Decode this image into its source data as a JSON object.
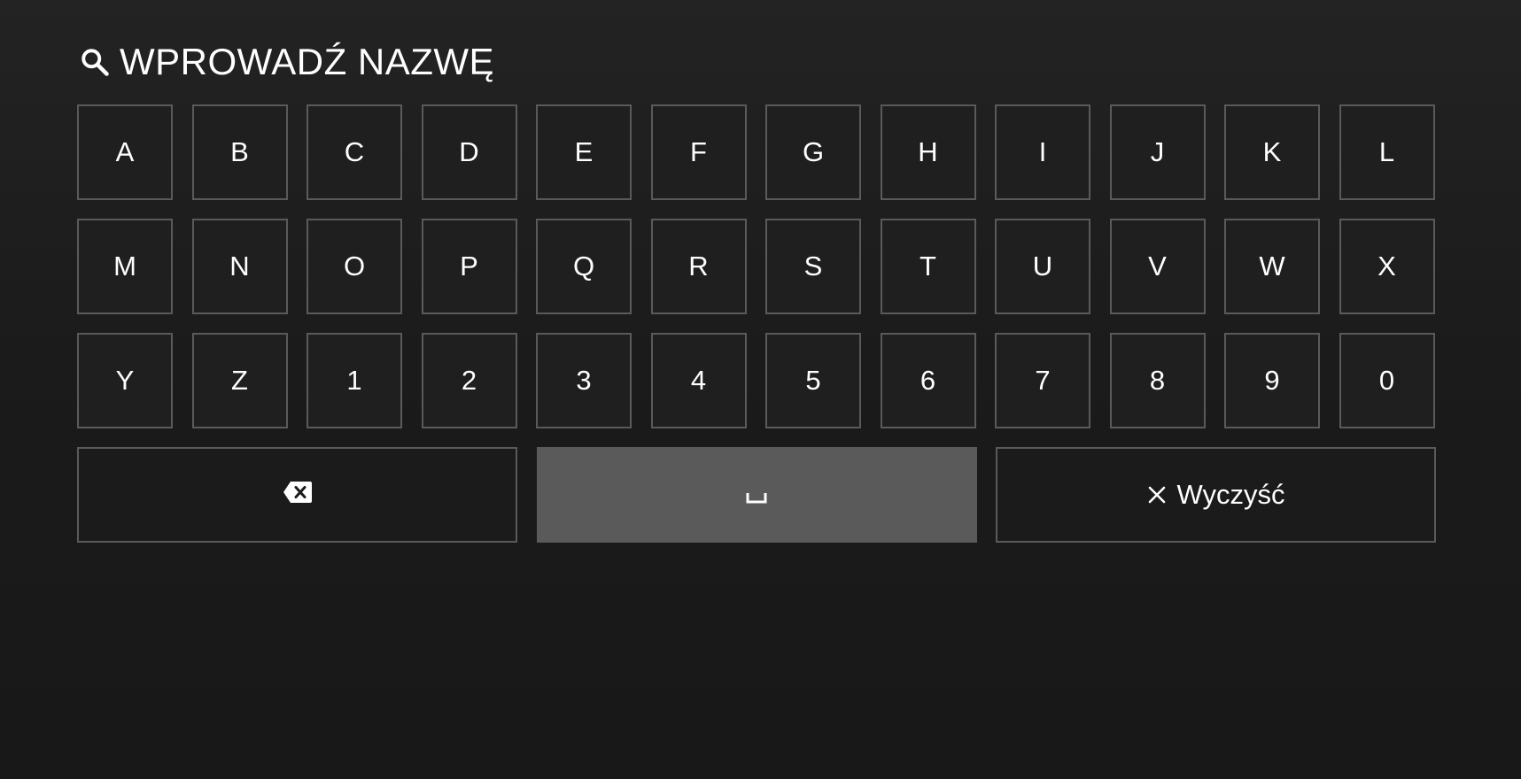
{
  "header": {
    "icon": "search-icon",
    "title": "WPROWADŹ NAZWĘ"
  },
  "keyboard": {
    "rows": [
      [
        "A",
        "B",
        "C",
        "D",
        "E",
        "F",
        "G",
        "H",
        "I",
        "J",
        "K",
        "L"
      ],
      [
        "M",
        "N",
        "O",
        "P",
        "Q",
        "R",
        "S",
        "T",
        "U",
        "V",
        "W",
        "X"
      ],
      [
        "Y",
        "Z",
        "1",
        "2",
        "3",
        "4",
        "5",
        "6",
        "7",
        "8",
        "9",
        "0"
      ]
    ],
    "actions": {
      "backspace_icon": "backspace-icon",
      "space_icon": "space-bar-icon",
      "space_focused": true,
      "clear_icon": "close-icon",
      "clear_label": "Wyczyść"
    }
  },
  "colors": {
    "background_top": "#232323",
    "background_bottom": "#181818",
    "key_border": "#5a5a5a",
    "key_focused_bg": "#5a5a5a",
    "text": "#ffffff"
  }
}
